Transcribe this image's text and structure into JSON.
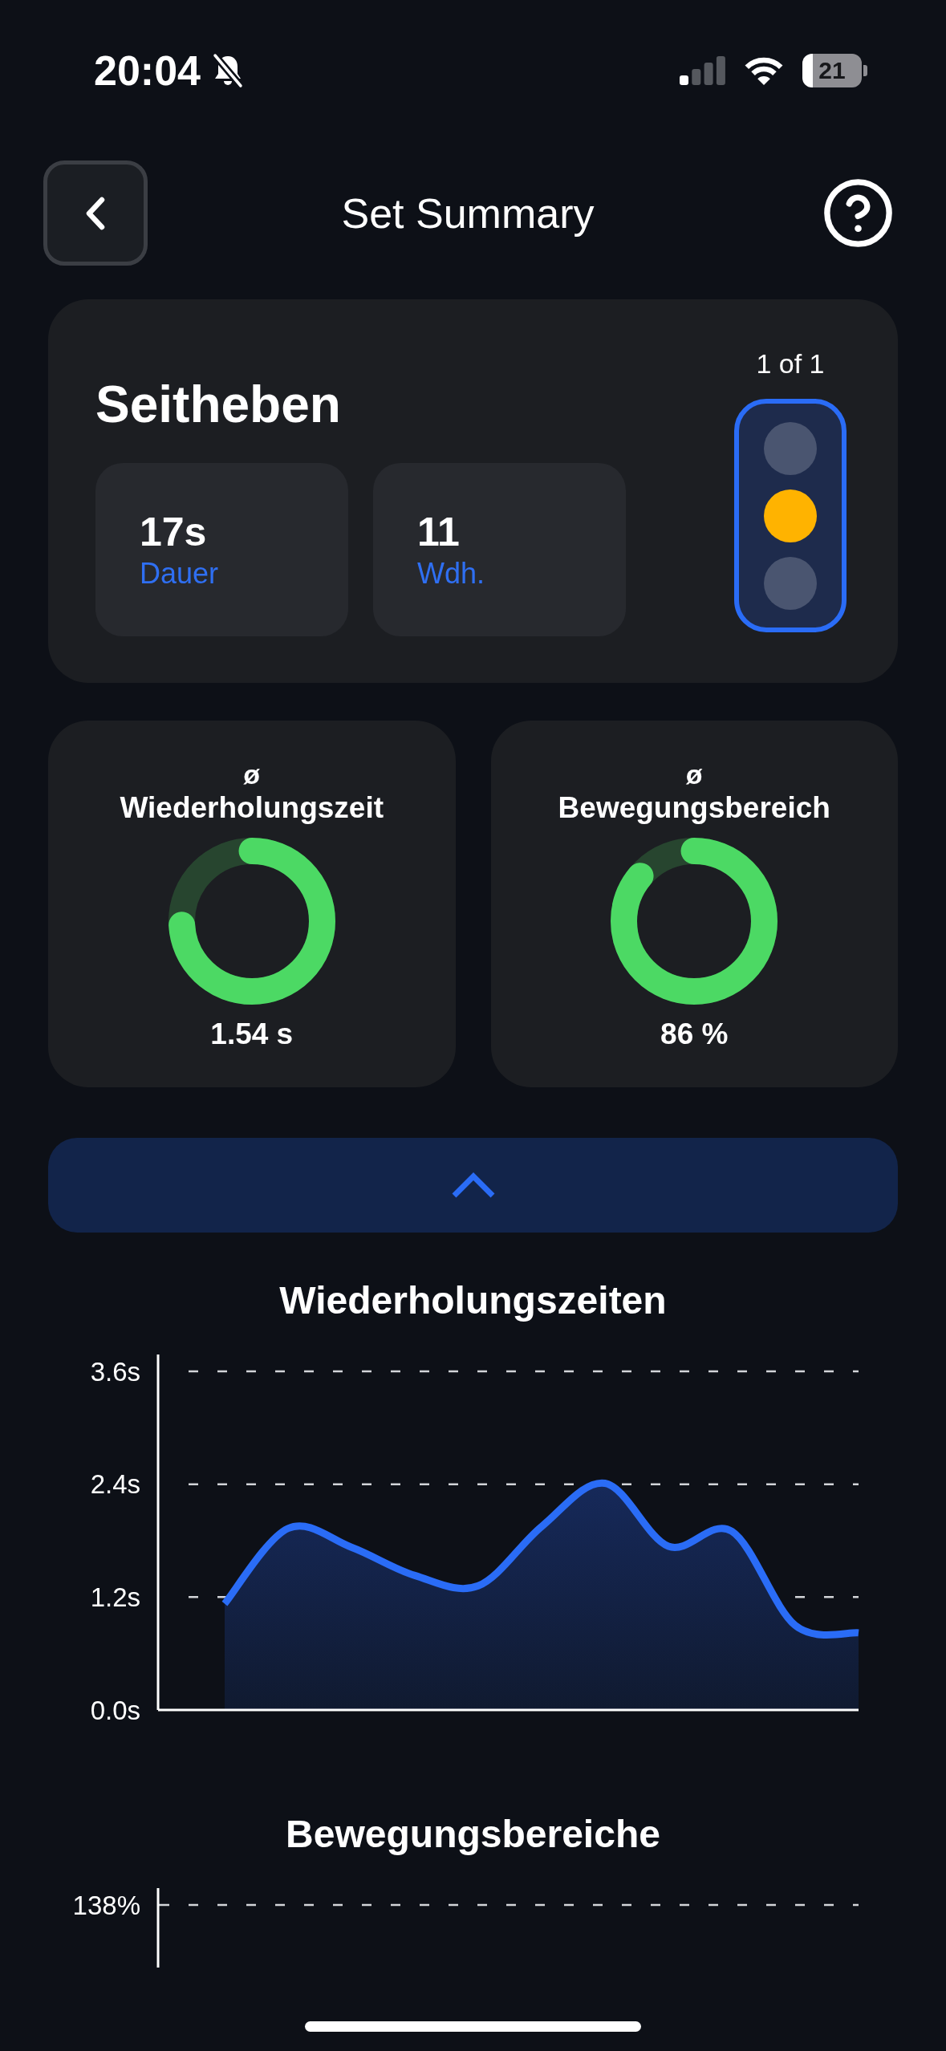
{
  "status_bar": {
    "time": "20:04",
    "silent": true,
    "battery": "21"
  },
  "header": {
    "title": "Set Summary"
  },
  "exercise": {
    "name": "Seitheben",
    "counter": "1 of 1",
    "stats": [
      {
        "value": "17s",
        "label": "Dauer"
      },
      {
        "value": "11",
        "label": "Wdh."
      }
    ],
    "lights": [
      {
        "selected": false
      },
      {
        "selected": true,
        "color": "#ffb300"
      },
      {
        "selected": false
      }
    ]
  },
  "averages": [
    {
      "symbol": "ø",
      "title": "Wiederholungszeit",
      "level": 0.74,
      "value": "1.54 s"
    },
    {
      "symbol": "ø",
      "title": "Bewegungsbereich",
      "level": 0.86,
      "value": "86 %"
    }
  ],
  "collapse_button": {
    "expanded": true
  },
  "rep_time_chart": {
    "chart_data": {
      "type": "area",
      "title": "Wiederholungszeiten",
      "values": [
        1.13,
        1.93,
        1.73,
        1.43,
        1.32,
        1.95,
        2.41,
        1.74,
        1.9,
        0.9,
        0.82
      ],
      "ylim": [
        0,
        3.6
      ],
      "yticks": [
        {
          "value": 0,
          "label": "0.0s"
        },
        {
          "value": 1.2,
          "label": "1.2s"
        },
        {
          "value": 2.4,
          "label": "2.4s"
        },
        {
          "value": 3.6,
          "label": "3.6s"
        }
      ]
    }
  },
  "range_chart": {
    "title": "Bewegungsbereiche",
    "tick_label": "138%"
  }
}
